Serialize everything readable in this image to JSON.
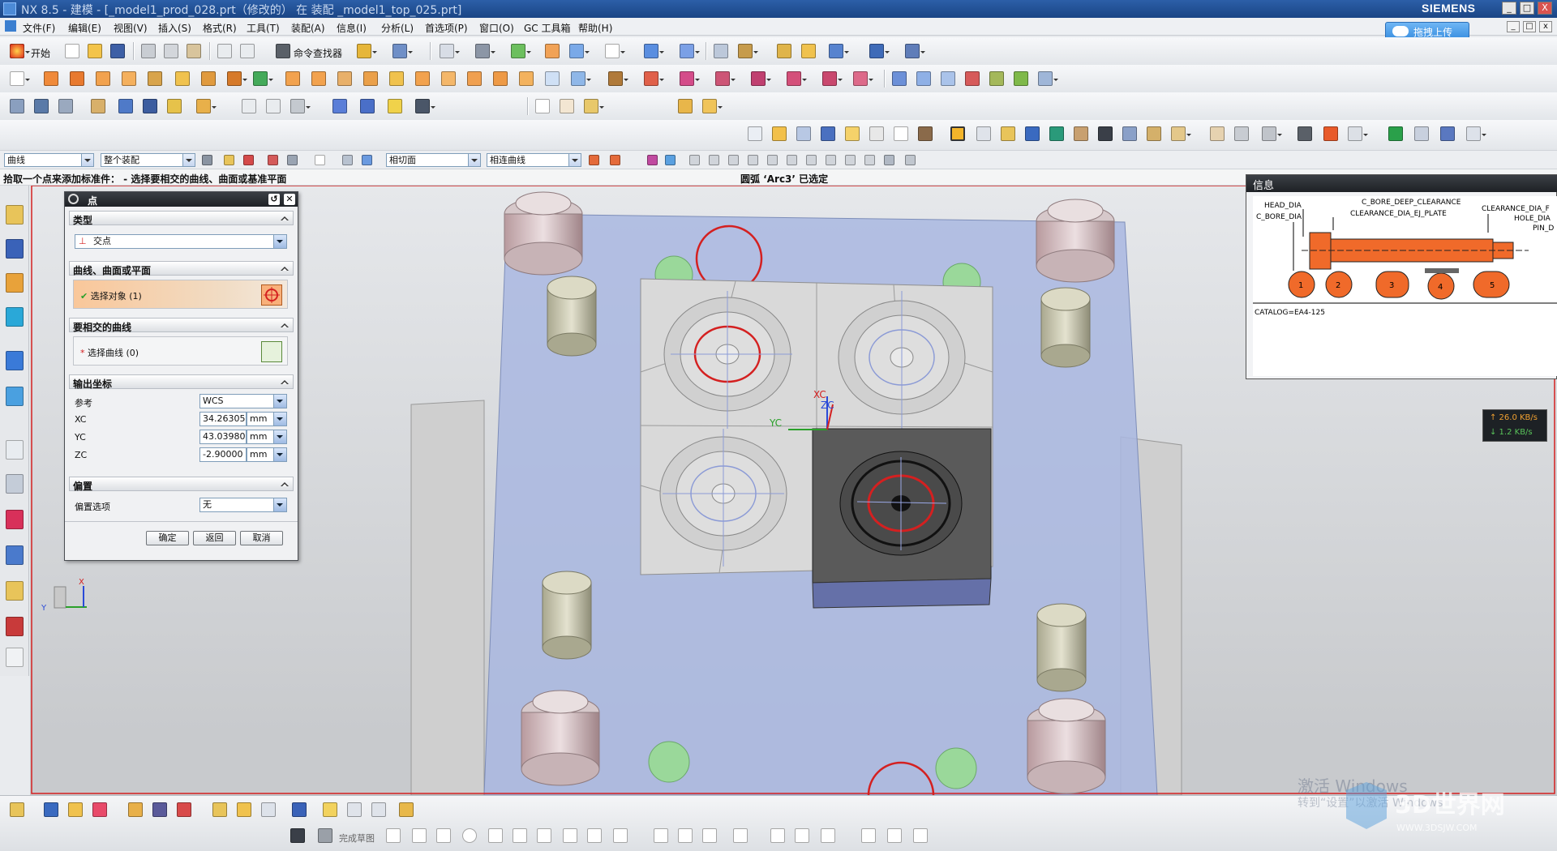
{
  "titlebar": {
    "title": "NX 8.5 - 建模 - [_model1_prod_028.prt（修改的） 在 装配 _model1_top_025.prt]",
    "brand": "SIEMENS",
    "min": "_",
    "max": "□",
    "close": "X"
  },
  "menubar": {
    "items": [
      "文件(F)",
      "编辑(E)",
      "视图(V)",
      "插入(S)",
      "格式(R)",
      "工具(T)",
      "装配(A)",
      "信息(I)",
      "分析(L)",
      "首选项(P)",
      "窗口(O)",
      "GC 工具箱",
      "帮助(H)"
    ],
    "cloud_upload": "拖拽上传"
  },
  "toolbar": {
    "start_label": "开始",
    "command_finder": "命令查找器"
  },
  "filterbar": {
    "type_filter": "曲线",
    "scope": "整个装配",
    "section_filter": "相切面",
    "curve_rule": "相连曲线"
  },
  "cuebar": {
    "prompt": "拾取一个点来添加标准件： - 选择要相交的曲线、曲面或基准平面",
    "status": "圆弧 ‘Arc3’ 已选定"
  },
  "dialog": {
    "title": "点",
    "type_group": "类型",
    "type_value": "交点",
    "group_curve_surface": "曲线、曲面或平面",
    "select_object": "选择对象 (1)",
    "group_intersect_curve": "要相交的曲线",
    "select_curve": "选择曲线 (0)",
    "group_output": "输出坐标",
    "ref_label": "参考",
    "ref_value": "WCS",
    "xc_label": "XC",
    "xc_value": "34.26305",
    "yc_label": "YC",
    "yc_value": "43.03980",
    "zc_label": "ZC",
    "zc_value": "-2.90000",
    "unit": "mm",
    "group_offset": "偏置",
    "offset_label": "偏置选项",
    "offset_value": "无",
    "ok": "确定",
    "back": "返回",
    "cancel": "取消"
  },
  "info": {
    "title": "信息",
    "labels": {
      "head_dia": "HEAD_DIA",
      "c_bore_dia": "C_BORE_DIA",
      "c_bore_deep": "C_BORE_DEEP_CLEARANCE",
      "clearance_ej": "CLEARANCE_DIA_EJ_PLATE",
      "clearance_dia": "CLEARANCE_DIA_F",
      "hole_dia": "HOLE_DIA",
      "pin_d": "PIN_D",
      "catalog": "CATALOG=EA4-125"
    },
    "variants": [
      "1",
      "2",
      "3",
      "4",
      "5"
    ]
  },
  "network": {
    "up": "↑ 26.0 KB/s",
    "down": "↓ 1.2 KB/s"
  },
  "viewport": {
    "axis_xc": "XC",
    "axis_yc": "YC",
    "axis_zc": "ZC",
    "triad_x": "X",
    "triad_y": "Y"
  },
  "bottom": {
    "finish_sketch": "完成草图"
  },
  "watermark": {
    "activate": "激活 Windows",
    "activate_sub": "转到“设置”以激活 Windows",
    "site": "3D世界网",
    "url": "WWW.3DSJW.COM"
  },
  "colors": {
    "accent_red": "#d42020",
    "plate_blue": "#a9b7e0",
    "dialog_title": "#2b2e33",
    "orange_pin": "#f06a2a"
  }
}
